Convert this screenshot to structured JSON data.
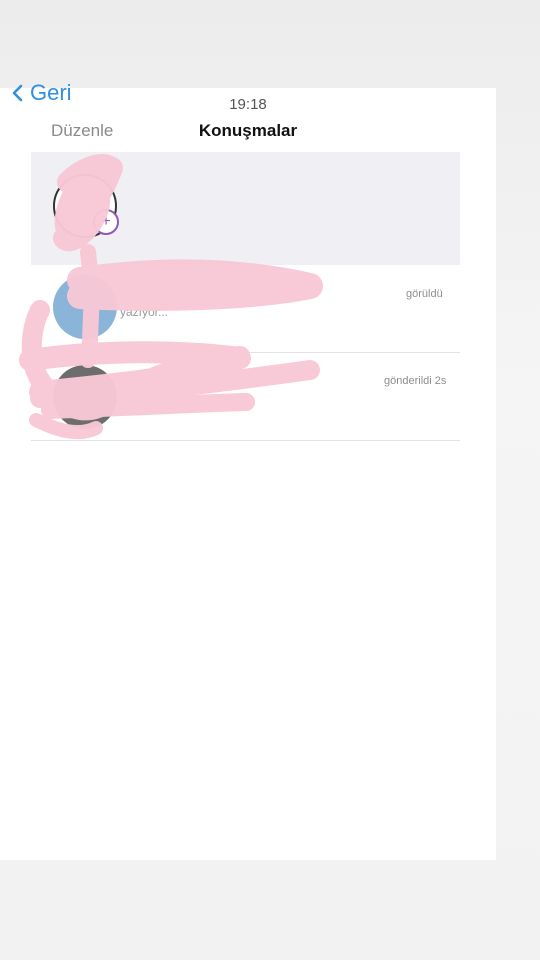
{
  "header": {
    "back_label": "Geri",
    "time": "19:18",
    "edit_label": "Düzenle",
    "title": "Konuşmalar"
  },
  "conversations": [
    {
      "status": "görüldü",
      "preview": "yazıyor..."
    },
    {
      "status": "gönderildi 2s"
    }
  ],
  "colors": {
    "accent": "#2f8fe0",
    "scribble": "#f8c8d6",
    "story_row_bg": "#efeff4"
  },
  "icons": [
    "chevron-left-icon",
    "add-story-icon"
  ]
}
